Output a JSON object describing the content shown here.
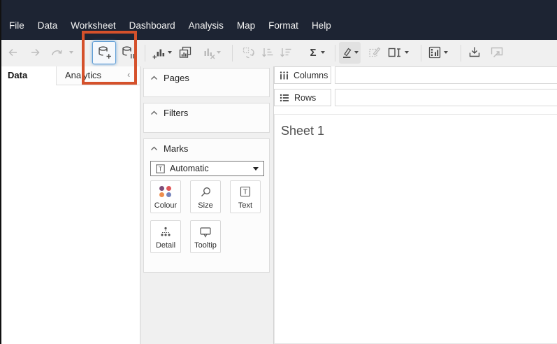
{
  "colors": {
    "menu_bar_bg": "#1d2433",
    "annotation_red": "#d5512b",
    "focus_blue": "#5b9bd5",
    "dot_purple": "#7d4d79",
    "dot_red": "#e05759",
    "dot_orange": "#ee8e4e",
    "dot_blue": "#7583bb"
  },
  "menu_bar": {
    "items": [
      "File",
      "Data",
      "Worksheet",
      "Dashboard",
      "Analysis",
      "Map",
      "Format",
      "Help"
    ]
  },
  "toolbar": {
    "sigma_label": "Σ",
    "icons": [
      "back-icon",
      "forward-icon",
      "redo-icon",
      "new-data-source-icon",
      "pause-auto-updates-icon",
      "new-worksheet-icon",
      "duplicate-sheet-icon",
      "clear-sheet-icon",
      "swap-rows-columns-icon",
      "sort-ascending-icon",
      "sort-descending-icon",
      "totals-sigma-icon",
      "highlight-icon",
      "edit-axis-icon",
      "fit-selector-icon",
      "show-me-icon",
      "download-icon",
      "presentation-mode-icon"
    ]
  },
  "data_pane": {
    "tabs": [
      {
        "label": "Data"
      },
      {
        "label": "Analytics"
      }
    ],
    "collapse_glyph": "‹"
  },
  "cards": {
    "pages": {
      "title": "Pages"
    },
    "filters": {
      "title": "Filters"
    },
    "marks": {
      "title": "Marks",
      "mark_type": "Automatic",
      "mark_type_icon_letter": "T",
      "buttons": [
        {
          "label": "Colour"
        },
        {
          "label": "Size"
        },
        {
          "label": "Text"
        },
        {
          "label": "Detail"
        },
        {
          "label": "Tooltip"
        }
      ]
    }
  },
  "shelves": {
    "columns_label": "Columns",
    "rows_label": "Rows"
  },
  "sheet": {
    "title": "Sheet 1"
  }
}
